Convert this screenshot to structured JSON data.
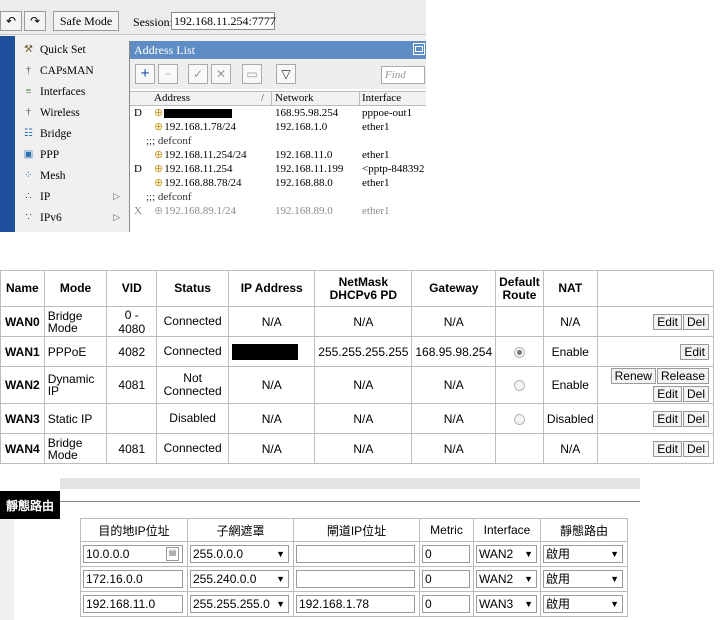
{
  "winbox": {
    "toolbar": {
      "undo_icon": "undo-icon",
      "redo_icon": "redo-icon",
      "safe_mode_label": "Safe Mode",
      "session_label": "Session:",
      "session_value": "192.168.11.254:7777"
    },
    "menu": [
      {
        "label": "Quick Set",
        "icon": "quick-set-icon",
        "arrow": false
      },
      {
        "label": "CAPsMAN",
        "icon": "capsman-icon",
        "arrow": false
      },
      {
        "label": "Interfaces",
        "icon": "interfaces-icon",
        "arrow": false
      },
      {
        "label": "Wireless",
        "icon": "wireless-icon",
        "arrow": false
      },
      {
        "label": "Bridge",
        "icon": "bridge-icon",
        "arrow": false
      },
      {
        "label": "PPP",
        "icon": "ppp-icon",
        "arrow": false
      },
      {
        "label": "Mesh",
        "icon": "mesh-icon",
        "arrow": false
      },
      {
        "label": "IP",
        "icon": "ip-icon",
        "arrow": true
      },
      {
        "label": "IPv6",
        "icon": "ipv6-icon",
        "arrow": true
      }
    ],
    "window": {
      "title": "Address List",
      "find_placeholder": "Find",
      "columns": {
        "address": "Address",
        "network": "Network",
        "interface": "Interface"
      },
      "rows": [
        {
          "kind": "entry",
          "flag": "D",
          "address": "",
          "redacted": true,
          "network": "168.95.98.254",
          "interface": "pppoe-out1",
          "disabled": false
        },
        {
          "kind": "entry",
          "flag": "",
          "address": "192.168.1.78/24",
          "redacted": false,
          "network": "192.168.1.0",
          "interface": "ether1",
          "disabled": false
        },
        {
          "kind": "comment",
          "text": ";;; defconf"
        },
        {
          "kind": "entry",
          "flag": "",
          "address": "192.168.11.254/24",
          "redacted": false,
          "network": "192.168.11.0",
          "interface": "ether1",
          "disabled": false
        },
        {
          "kind": "entry",
          "flag": "D",
          "address": "192.168.11.254",
          "redacted": false,
          "network": "192.168.11.199",
          "interface": "<pptp-848392",
          "disabled": false
        },
        {
          "kind": "entry",
          "flag": "",
          "address": "192.168.88.78/24",
          "redacted": false,
          "network": "192.168.88.0",
          "interface": "ether1",
          "disabled": false
        },
        {
          "kind": "comment",
          "text": ";;; defconf"
        },
        {
          "kind": "entry",
          "flag": "X",
          "address": "192.168.89.1/24",
          "redacted": false,
          "network": "192.168.89.0",
          "interface": "ether1",
          "disabled": true
        }
      ]
    }
  },
  "wan_table": {
    "headers": {
      "name": "Name",
      "mode": "Mode",
      "vid": "VID",
      "status": "Status",
      "ip": "IP Address",
      "netmask_line1": "NetMask",
      "netmask_line2": "DHCPv6 PD",
      "gateway": "Gateway",
      "default_route_line1": "Default",
      "default_route_line2": "Route",
      "nat": "NAT"
    },
    "rows": [
      {
        "name": "WAN0",
        "mode_line1": "Bridge",
        "mode_line2": "Mode",
        "vid": "0 - 4080",
        "status_line1": "Connected",
        "status_line2": "",
        "ip": "N/A",
        "ip_redacted": false,
        "netmask": "N/A",
        "gateway": "N/A",
        "radio": "none",
        "nat": "N/A",
        "buttons_top": [],
        "buttons_bottom": [
          "Edit",
          "Del"
        ]
      },
      {
        "name": "WAN1",
        "mode_line1": "PPPoE",
        "mode_line2": "",
        "vid": "4082",
        "status_line1": "Connected",
        "status_line2": "",
        "ip": "",
        "ip_redacted": true,
        "netmask": "255.255.255.255",
        "gateway": "168.95.98.254",
        "radio": "checked",
        "nat": "Enable",
        "buttons_top": [],
        "buttons_bottom": [
          "Edit"
        ]
      },
      {
        "name": "WAN2",
        "mode_line1": "Dynamic",
        "mode_line2": "IP",
        "vid": "4081",
        "status_line1": "Not",
        "status_line2": "Connected",
        "ip": "N/A",
        "ip_redacted": false,
        "netmask": "N/A",
        "gateway": "N/A",
        "radio": "unchecked",
        "nat": "Enable",
        "buttons_top": [
          "Renew",
          "Release"
        ],
        "buttons_bottom": [
          "Edit",
          "Del"
        ]
      },
      {
        "name": "WAN3",
        "mode_line1": "Static IP",
        "mode_line2": "",
        "vid": "",
        "status_line1": "Disabled",
        "status_line2": "",
        "ip": "N/A",
        "ip_redacted": false,
        "netmask": "N/A",
        "gateway": "N/A",
        "radio": "unchecked",
        "nat": "Disabled",
        "buttons_top": [],
        "buttons_bottom": [
          "Edit",
          "Del"
        ]
      },
      {
        "name": "WAN4",
        "mode_line1": "Bridge",
        "mode_line2": "Mode",
        "vid": "4081",
        "status_line1": "Connected",
        "status_line2": "",
        "ip": "N/A",
        "ip_redacted": false,
        "netmask": "N/A",
        "gateway": "N/A",
        "radio": "none",
        "nat": "N/A",
        "buttons_top": [],
        "buttons_bottom": [
          "Edit",
          "Del"
        ]
      }
    ]
  },
  "static_route": {
    "title": "靜態路由",
    "headers": {
      "dest": "目的地IP位址",
      "mask": "子網遮罩",
      "gateway": "閘道IP位址",
      "metric": "Metric",
      "interface": "Interface",
      "route": "靜態路由"
    },
    "rows": [
      {
        "dest": "10.0.0.0",
        "dest_icon": true,
        "mask": "255.0.0.0",
        "gateway": "",
        "metric": "0",
        "interface": "WAN2",
        "route": "啟用"
      },
      {
        "dest": "172.16.0.0",
        "dest_icon": false,
        "mask": "255.240.0.0",
        "gateway": "",
        "metric": "0",
        "interface": "WAN2",
        "route": "啟用"
      },
      {
        "dest": "192.168.11.0",
        "dest_icon": false,
        "mask": "255.255.255.0",
        "gateway": "192.168.1.78",
        "metric": "0",
        "interface": "WAN3",
        "route": "啟用"
      }
    ]
  }
}
